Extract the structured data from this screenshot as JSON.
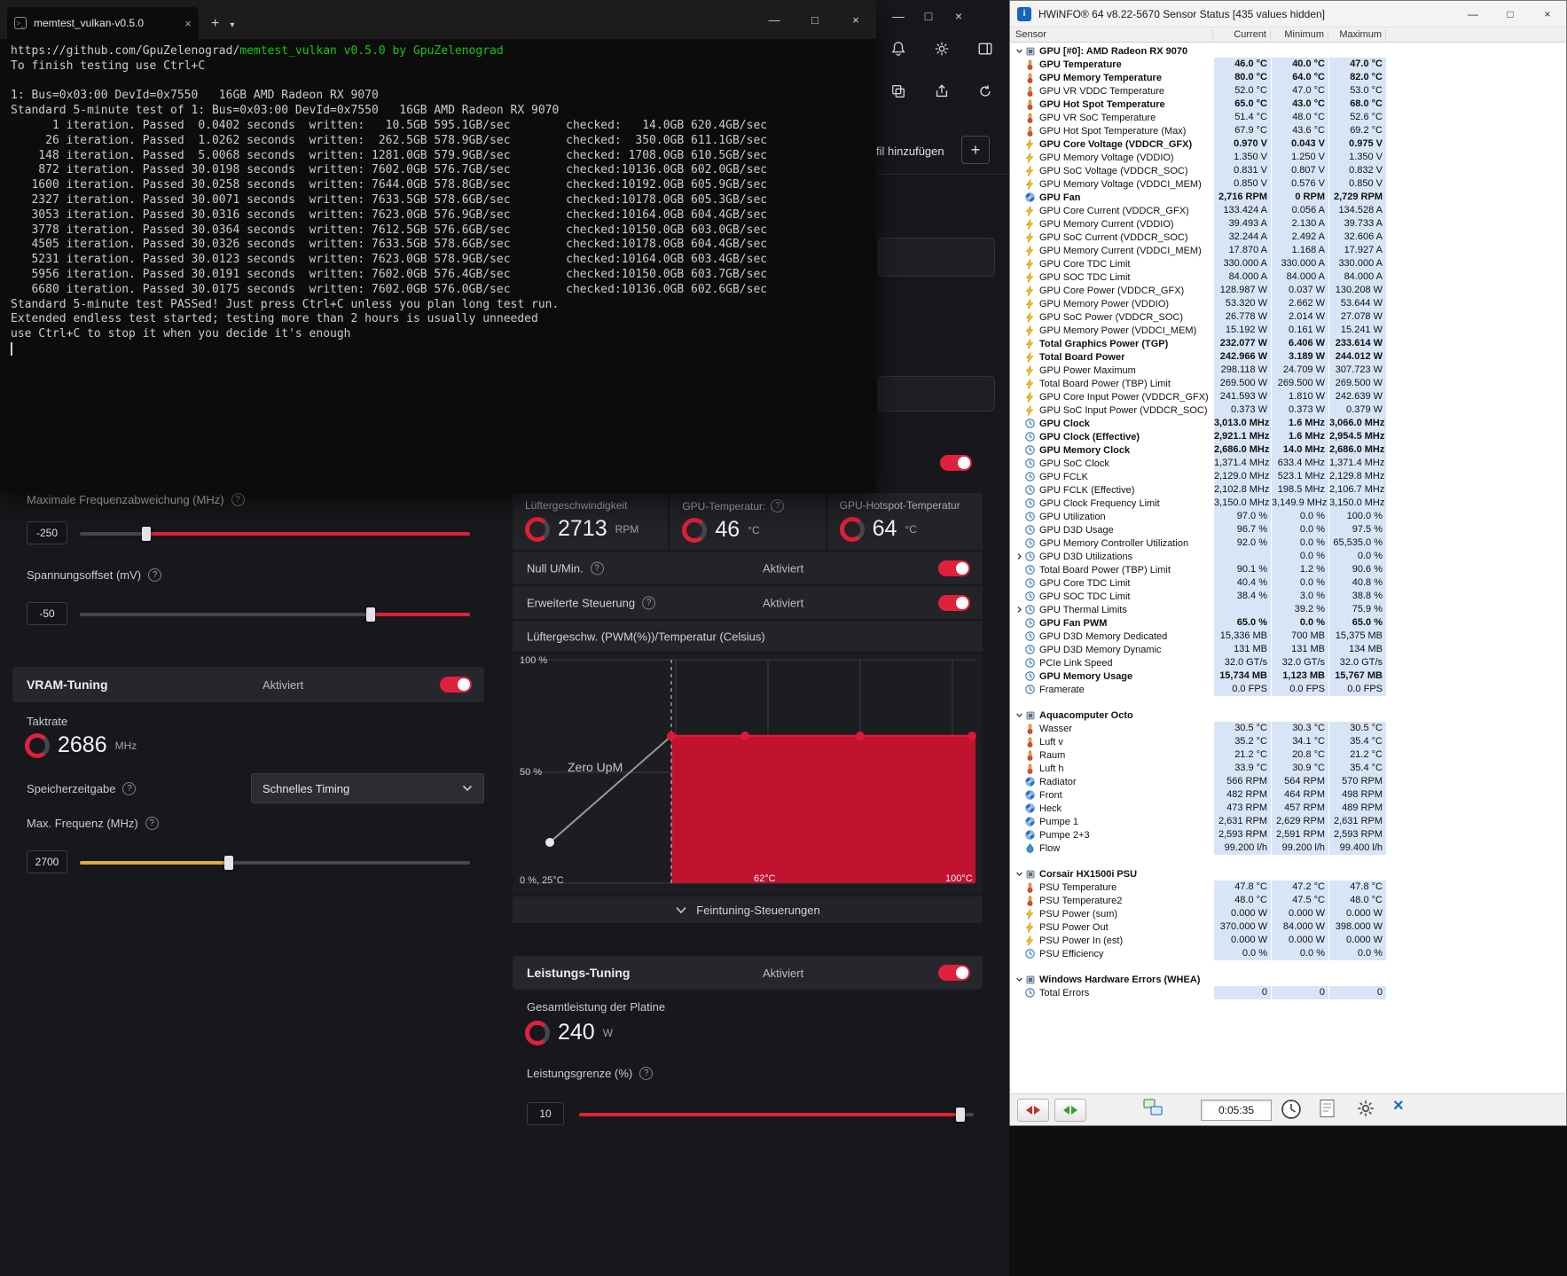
{
  "terminal": {
    "tab_title": "memtest_vulkan-v0.5.0",
    "url_prefix": "https://github.com/GpuZelenograd/",
    "url_highlight": "memtest_vulkan v0.5.0 by GpuZelenograd",
    "body": "To finish testing use Ctrl+C\n\n1: Bus=0x03:00 DevId=0x7550   16GB AMD Radeon RX 9070\nStandard 5-minute test of 1: Bus=0x03:00 DevId=0x7550   16GB AMD Radeon RX 9070\n      1 iteration. Passed  0.0402 seconds  written:   10.5GB 595.1GB/sec        checked:   14.0GB 620.4GB/sec\n     26 iteration. Passed  1.0262 seconds  written:  262.5GB 578.9GB/sec        checked:  350.0GB 611.1GB/sec\n    148 iteration. Passed  5.0068 seconds  written: 1281.0GB 579.9GB/sec        checked: 1708.0GB 610.5GB/sec\n    872 iteration. Passed 30.0198 seconds  written: 7602.0GB 576.7GB/sec        checked:10136.0GB 602.0GB/sec\n   1600 iteration. Passed 30.0258 seconds  written: 7644.0GB 578.8GB/sec        checked:10192.0GB 605.9GB/sec\n   2327 iteration. Passed 30.0071 seconds  written: 7633.5GB 578.6GB/sec        checked:10178.0GB 605.3GB/sec\n   3053 iteration. Passed 30.0316 seconds  written: 7623.0GB 576.9GB/sec        checked:10164.0GB 604.4GB/sec\n   3778 iteration. Passed 30.0364 seconds  written: 7612.5GB 576.6GB/sec        checked:10150.0GB 603.0GB/sec\n   4505 iteration. Passed 30.0326 seconds  written: 7633.5GB 578.6GB/sec        checked:10178.0GB 604.4GB/sec\n   5231 iteration. Passed 30.0123 seconds  written: 7623.0GB 578.9GB/sec        checked:10164.0GB 603.4GB/sec\n   5956 iteration. Passed 30.0191 seconds  written: 7602.0GB 576.4GB/sec        checked:10150.0GB 603.7GB/sec\n   6680 iteration. Passed 30.0175 seconds  written: 7602.0GB 576.0GB/sec        checked:10136.0GB 602.6GB/sec\nStandard 5-minute test PASSed! Just press Ctrl+C unless you plan long test run.\nExtended endless test started; testing more than 2 hours is usually unneeded\nuse Ctrl+C to stop it when you decide it's enough"
  },
  "adrenalin": {
    "profile_button": "fil hinzufügen",
    "accent_color": "#e0203c",
    "tuning": {
      "max_dev_label": "Maximale Frequenzabweichung (MHz)",
      "max_dev_value": "-250",
      "voffset_label": "Spannungsoffset (mV)",
      "voffset_value": "-50",
      "vram_title": "VRAM-Tuning",
      "vram_state": "Aktiviert",
      "clock_label": "Taktrate",
      "clock_value": "2686",
      "clock_unit": "MHz",
      "timing_label": "Speicherzeitgabe",
      "timing_value": "Schnelles Timing",
      "maxfreq_label": "Max. Frequenz (MHz)",
      "maxfreq_value": "2700"
    },
    "fan": {
      "speed_label": "Lüftergeschwindigkeit",
      "speed_value": "2713",
      "speed_unit": "RPM",
      "temp_label": "GPU-Temperatur:",
      "temp_value": "46",
      "temp_unit": "°C",
      "hotspot_label": "GPU-Hotspot-Temperatur",
      "hotspot_value": "64",
      "hotspot_unit": "°C",
      "zero_label": "Null U/Min.",
      "zero_state": "Aktiviert",
      "adv_label": "Erweiterte Steuerung",
      "adv_state": "Aktiviert",
      "chart_title": "Lüftergeschw. (PWM(%))/Temperatur (Celsius)",
      "y100": "100 %",
      "y50": "50 %",
      "origin": "0 %, 25°C",
      "x62": "62°C",
      "x100": "100°C",
      "zero_rpm_text": "Zero UpM",
      "fine_label": "Feintuning-Steuerungen",
      "curve_points_temp_pwm": [
        [
          25,
          0
        ],
        [
          62,
          65
        ],
        [
          70,
          65
        ],
        [
          83,
          65
        ],
        [
          100,
          65
        ]
      ]
    },
    "power": {
      "title": "Leistungs-Tuning",
      "state": "Aktiviert",
      "tbp_label": "Gesamtleistung der Platine",
      "tbp_value": "240",
      "tbp_unit": "W",
      "limit_label": "Leistungsgrenze (%)",
      "limit_value": "10"
    }
  },
  "hwinfo": {
    "title": "HWiNFO® 64 v8.22-5670 Sensor Status [435 values hidden]",
    "timer": "0:05:35",
    "columns": {
      "sensor": "Sensor",
      "current": "Current",
      "minimum": "Minimum",
      "maximum": "Maximum"
    },
    "groups": [
      {
        "name": "GPU [#0]: AMD Radeon RX 9070",
        "rows": [
          [
            "GPU Temperature",
            "46.0 °C",
            "40.0 °C",
            "47.0 °C",
            "temp",
            1,
            0
          ],
          [
            "GPU Memory Temperature",
            "80.0 °C",
            "64.0 °C",
            "82.0 °C",
            "temp",
            1,
            0
          ],
          [
            "GPU VR VDDC Temperature",
            "52.0 °C",
            "47.0 °C",
            "53.0 °C",
            "temp",
            0,
            0
          ],
          [
            "GPU Hot Spot Temperature",
            "65.0 °C",
            "43.0 °C",
            "68.0 °C",
            "temp",
            1,
            0
          ],
          [
            "GPU VR SoC Temperature",
            "51.4 °C",
            "48.0 °C",
            "52.6 °C",
            "temp",
            0,
            0
          ],
          [
            "GPU Hot Spot Temperature (Max)",
            "67.9 °C",
            "43.6 °C",
            "69.2 °C",
            "temp",
            0,
            0
          ],
          [
            "GPU Core Voltage (VDDCR_GFX)",
            "0.970 V",
            "0.043 V",
            "0.975 V",
            "bolt",
            1,
            0
          ],
          [
            "GPU Memory Voltage (VDDIO)",
            "1.350 V",
            "1.250 V",
            "1.350 V",
            "bolt",
            0,
            0
          ],
          [
            "GPU SoC Voltage (VDDCR_SOC)",
            "0.831 V",
            "0.807 V",
            "0.832 V",
            "bolt",
            0,
            0
          ],
          [
            "GPU Memory Voltage (VDDCI_MEM)",
            "0.850 V",
            "0.576 V",
            "0.850 V",
            "bolt",
            0,
            0
          ],
          [
            "GPU Fan",
            "2,716 RPM",
            "0 RPM",
            "2,729 RPM",
            "fan",
            1,
            0
          ],
          [
            "GPU Core Current (VDDCR_GFX)",
            "133.424 A",
            "0.056 A",
            "134.528 A",
            "bolt",
            0,
            0
          ],
          [
            "GPU Memory Current (VDDIO)",
            "39.493 A",
            "2.130 A",
            "39.733 A",
            "bolt",
            0,
            0
          ],
          [
            "GPU SoC Current (VDDCR_SOC)",
            "32.244 A",
            "2.492 A",
            "32.606 A",
            "bolt",
            0,
            0
          ],
          [
            "GPU Memory Current (VDDCI_MEM)",
            "17.870 A",
            "1.168 A",
            "17.927 A",
            "bolt",
            0,
            0
          ],
          [
            "GPU Core TDC Limit",
            "330.000 A",
            "330.000 A",
            "330.000 A",
            "bolt",
            0,
            0
          ],
          [
            "GPU SOC TDC Limit",
            "84.000 A",
            "84.000 A",
            "84.000 A",
            "bolt",
            0,
            0
          ],
          [
            "GPU Core Power (VDDCR_GFX)",
            "128.987 W",
            "0.037 W",
            "130.208 W",
            "bolt",
            0,
            0
          ],
          [
            "GPU Memory Power (VDDIO)",
            "53.320 W",
            "2.662 W",
            "53.644 W",
            "bolt",
            0,
            0
          ],
          [
            "GPU SoC Power (VDDCR_SOC)",
            "26.778 W",
            "2.014 W",
            "27.078 W",
            "bolt",
            0,
            0
          ],
          [
            "GPU Memory Power (VDDCI_MEM)",
            "15.192 W",
            "0.161 W",
            "15.241 W",
            "bolt",
            0,
            0
          ],
          [
            "Total Graphics Power (TGP)",
            "232.077 W",
            "6.406 W",
            "233.614 W",
            "bolt",
            1,
            0
          ],
          [
            "Total Board Power",
            "242.966 W",
            "3.189 W",
            "244.012 W",
            "bolt",
            1,
            0
          ],
          [
            "GPU Power Maximum",
            "298.118 W",
            "24.709 W",
            "307.723 W",
            "bolt",
            0,
            0
          ],
          [
            "Total Board Power (TBP) Limit",
            "269.500 W",
            "269.500 W",
            "269.500 W",
            "bolt",
            0,
            0
          ],
          [
            "GPU Core Input Power (VDDCR_GFX)",
            "241.593 W",
            "1.810 W",
            "242.639 W",
            "bolt",
            0,
            0
          ],
          [
            "GPU SoC Input Power (VDDCR_SOC)",
            "0.373 W",
            "0.373 W",
            "0.379 W",
            "bolt",
            0,
            0
          ],
          [
            "GPU Clock",
            "3,013.0 MHz",
            "1.6 MHz",
            "3,066.0 MHz",
            "clock",
            1,
            0
          ],
          [
            "GPU Clock (Effective)",
            "2,921.1 MHz",
            "1.6 MHz",
            "2,954.5 MHz",
            "clock",
            1,
            0
          ],
          [
            "GPU Memory Clock",
            "2,686.0 MHz",
            "14.0 MHz",
            "2,686.0 MHz",
            "clock",
            1,
            0
          ],
          [
            "GPU SoC Clock",
            "1,371.4 MHz",
            "633.4 MHz",
            "1,371.4 MHz",
            "clock",
            0,
            0
          ],
          [
            "GPU FCLK",
            "2,129.0 MHz",
            "523.1 MHz",
            "2,129.8 MHz",
            "clock",
            0,
            0
          ],
          [
            "GPU FCLK (Effective)",
            "2,102.8 MHz",
            "198.5 MHz",
            "2,106.7 MHz",
            "clock",
            0,
            0
          ],
          [
            "GPU Clock Frequency Limit",
            "3,150.0 MHz",
            "3,149.9 MHz",
            "3,150.0 MHz",
            "clock",
            0,
            0
          ],
          [
            "GPU Utilization",
            "97.0 %",
            "0.0 %",
            "100.0 %",
            "clock",
            0,
            0
          ],
          [
            "GPU D3D Usage",
            "96.7 %",
            "0.0 %",
            "97.5 %",
            "clock",
            0,
            0
          ],
          [
            "GPU Memory Controller Utilization",
            "92.0 %",
            "0.0 %",
            "65,535.0 %",
            "clock",
            0,
            0
          ],
          [
            "GPU D3D Utilizations",
            "",
            "0.0 %",
            "0.0 %",
            "clock",
            0,
            1
          ],
          [
            "Total Board Power (TBP) Limit",
            "90.1 %",
            "1.2 %",
            "90.6 %",
            "clock",
            0,
            0
          ],
          [
            "GPU Core TDC Limit",
            "40.4 %",
            "0.0 %",
            "40.8 %",
            "clock",
            0,
            0
          ],
          [
            "GPU SOC TDC Limit",
            "38.4 %",
            "3.0 %",
            "38.8 %",
            "clock",
            0,
            0
          ],
          [
            "GPU Thermal Limits",
            "",
            "39.2 %",
            "75.9 %",
            "clock",
            0,
            1
          ],
          [
            "GPU Fan PWM",
            "65.0 %",
            "0.0 %",
            "65.0 %",
            "clock",
            1,
            0
          ],
          [
            "GPU D3D Memory Dedicated",
            "15,336 MB",
            "700 MB",
            "15,375 MB",
            "clock",
            0,
            0
          ],
          [
            "GPU D3D Memory Dynamic",
            "131 MB",
            "131 MB",
            "134 MB",
            "clock",
            0,
            0
          ],
          [
            "PCIe Link Speed",
            "32.0 GT/s",
            "32.0 GT/s",
            "32.0 GT/s",
            "clock",
            0,
            0
          ],
          [
            "GPU Memory Usage",
            "15,734 MB",
            "1,123 MB",
            "15,767 MB",
            "clock",
            1,
            0
          ],
          [
            "Framerate",
            "0.0 FPS",
            "0.0 FPS",
            "0.0 FPS",
            "clock",
            0,
            0
          ]
        ]
      },
      {
        "name": "Aquacomputer Octo",
        "rows": [
          [
            "Wasser",
            "30.5 °C",
            "30.3 °C",
            "30.5 °C",
            "temp",
            0,
            0
          ],
          [
            "Luft v",
            "35.2 °C",
            "34.1 °C",
            "35.4 °C",
            "temp",
            0,
            0
          ],
          [
            "Raum",
            "21.2 °C",
            "20.8 °C",
            "21.2 °C",
            "temp",
            0,
            0
          ],
          [
            "Luft h",
            "33.9 °C",
            "30.9 °C",
            "35.4 °C",
            "temp",
            0,
            0
          ],
          [
            "Radiator",
            "566 RPM",
            "564 RPM",
            "570 RPM",
            "fan",
            0,
            0
          ],
          [
            "Front",
            "482 RPM",
            "464 RPM",
            "498 RPM",
            "fan",
            0,
            0
          ],
          [
            "Heck",
            "473 RPM",
            "457 RPM",
            "489 RPM",
            "fan",
            0,
            0
          ],
          [
            "Pumpe 1",
            "2,631 RPM",
            "2,629 RPM",
            "2,631 RPM",
            "fan",
            0,
            0
          ],
          [
            "Pumpe 2+3",
            "2,593 RPM",
            "2,591 RPM",
            "2,593 RPM",
            "fan",
            0,
            0
          ],
          [
            "Flow",
            "99.200 l/h",
            "99.200 l/h",
            "99.400 l/h",
            "flow",
            0,
            0
          ]
        ]
      },
      {
        "name": "Corsair HX1500i PSU",
        "rows": [
          [
            "PSU Temperature",
            "47.8 °C",
            "47.2 °C",
            "47.8 °C",
            "temp",
            0,
            0
          ],
          [
            "PSU Temperature2",
            "48.0 °C",
            "47.5 °C",
            "48.0 °C",
            "temp",
            0,
            0
          ],
          [
            "PSU Power (sum)",
            "0.000 W",
            "0.000 W",
            "0.000 W",
            "bolt",
            0,
            0
          ],
          [
            "PSU Power Out",
            "370.000 W",
            "84.000 W",
            "398.000 W",
            "bolt",
            0,
            0
          ],
          [
            "PSU Power In (est)",
            "0.000 W",
            "0.000 W",
            "0.000 W",
            "bolt",
            0,
            0
          ],
          [
            "PSU Efficiency",
            "0.0 %",
            "0.0 %",
            "0.0 %",
            "clock",
            0,
            0
          ]
        ]
      },
      {
        "name": "Windows Hardware Errors (WHEA)",
        "rows": [
          [
            "Total Errors",
            "0",
            "0",
            "0",
            "clock",
            0,
            0
          ]
        ]
      }
    ]
  }
}
